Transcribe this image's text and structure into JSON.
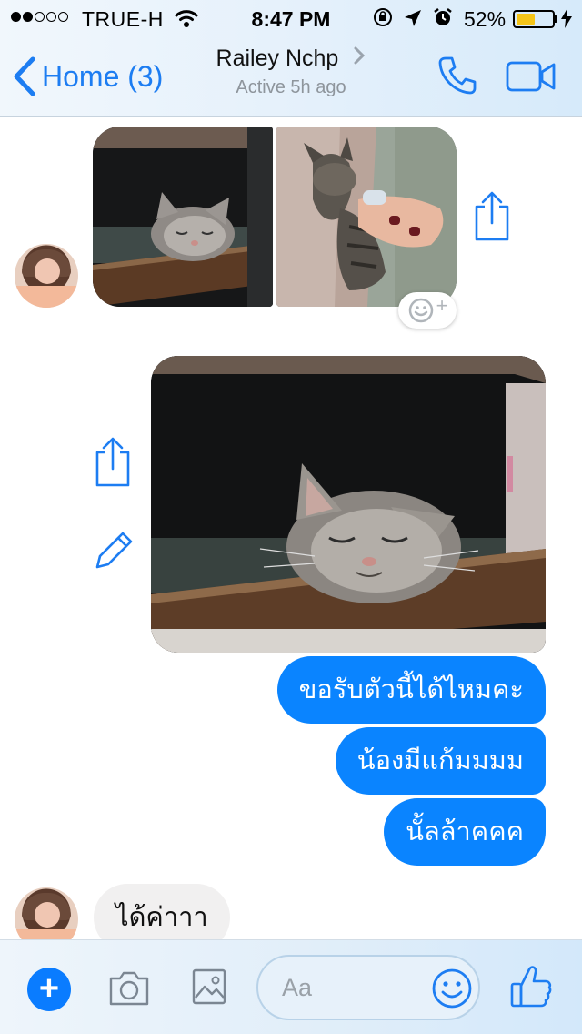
{
  "status_bar": {
    "carrier": "TRUE-H",
    "time": "8:47 PM",
    "battery_percent": "52%",
    "battery_level": 0.52,
    "signal_bars_filled": 2,
    "signal_bars_total": 5,
    "icons": [
      "wifi-icon",
      "orientation-lock-icon",
      "location-arrow-icon",
      "alarm-icon",
      "charging-bolt-icon"
    ]
  },
  "nav": {
    "back_label": "Home (3)",
    "contact_name": "Railey Nchp",
    "active_status": "Active 5h ago",
    "icons": [
      "back-chevron-icon",
      "chevron-right-icon",
      "phone-icon",
      "video-camera-icon"
    ]
  },
  "messages": [
    {
      "from": "them",
      "type": "photos",
      "count": 2
    },
    {
      "from": "me",
      "type": "photo"
    },
    {
      "from": "me",
      "type": "text",
      "text": "ขอรับตัวนี้ได้ไหมคะ"
    },
    {
      "from": "me",
      "type": "text",
      "text": "น้องมีแก้มมมม"
    },
    {
      "from": "me",
      "type": "text",
      "text": "นั้ลล้าคคค"
    },
    {
      "from": "them",
      "type": "text",
      "text": "ได้ค่าาา"
    }
  ],
  "composer": {
    "placeholder": "Aa",
    "icons": [
      "plus-icon",
      "camera-icon",
      "image-icon",
      "emoji-icon",
      "thumbs-up-icon"
    ]
  },
  "colors": {
    "accent": "#1d7df2",
    "outgoing_bubble": "#0a84ff",
    "incoming_bubble": "#f1f0f0",
    "battery": "#f5c518"
  }
}
